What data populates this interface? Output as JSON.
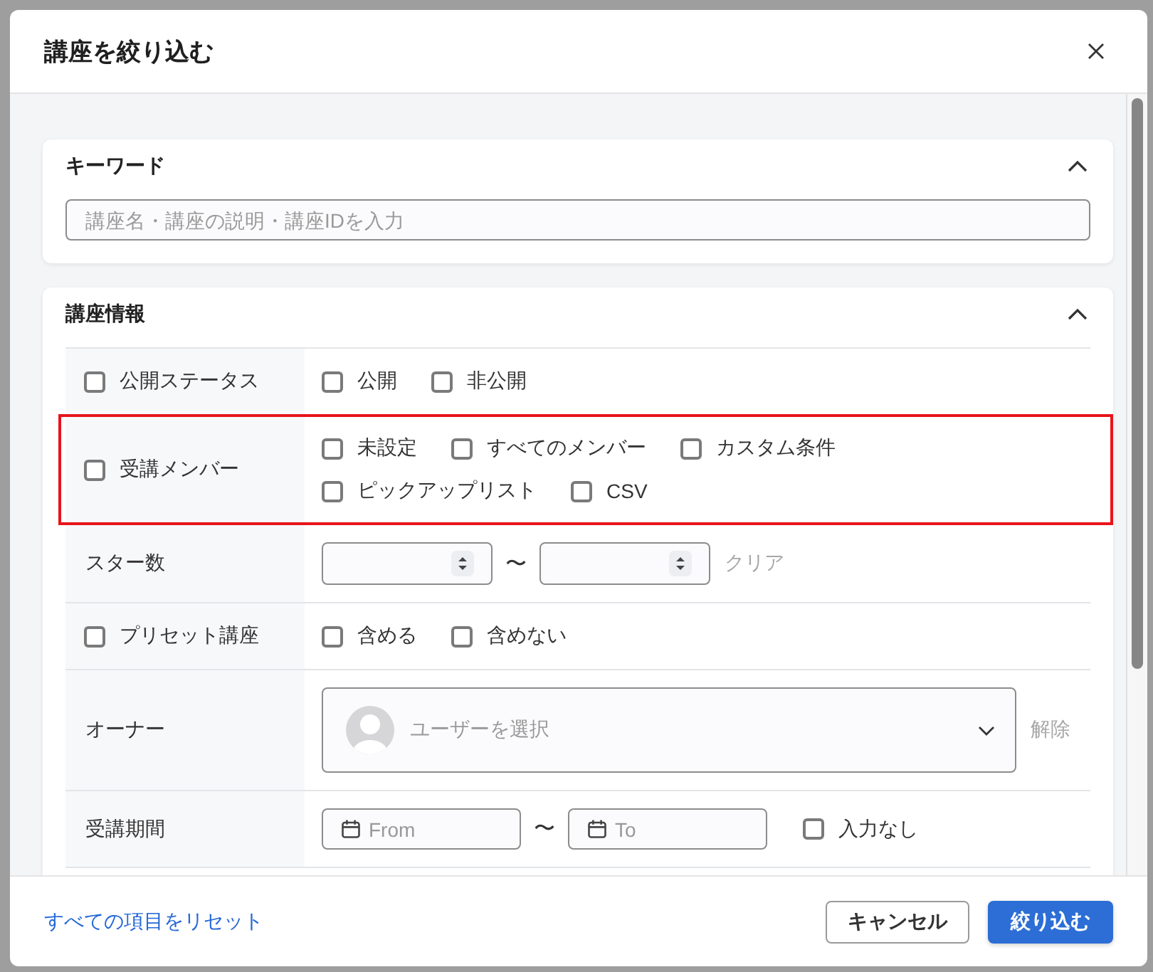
{
  "dialog": {
    "title": "講座を絞り込む"
  },
  "sections": [
    {
      "kind": "keyword",
      "title": "キーワード",
      "expanded": true,
      "search": {
        "placeholder": "講座名・講座の説明・講座IDを入力"
      }
    },
    {
      "kind": "table",
      "title": "講座情報",
      "expanded": true,
      "rows": [
        {
          "kind": "checks",
          "label": "公開ステータス",
          "checked": false,
          "highlighted": false,
          "options": [
            {
              "label": "公開",
              "checked": false
            },
            {
              "label": "非公開",
              "checked": false
            }
          ]
        },
        {
          "kind": "checks",
          "label": "受講メンバー",
          "checked": false,
          "highlighted": true,
          "options": [
            {
              "label": "未設定",
              "checked": false
            },
            {
              "label": "すべてのメンバー",
              "checked": false
            },
            {
              "label": "カスタム条件",
              "checked": false
            },
            {
              "label": "ピックアップリスト",
              "checked": false
            },
            {
              "label": "CSV",
              "checked": false
            }
          ]
        },
        {
          "kind": "number_range",
          "label": "スター数",
          "highlighted": false,
          "fields": [
            {
              "kind": "number"
            },
            {
              "kind": "number"
            }
          ],
          "separator": "〜",
          "clear_link": "クリア"
        },
        {
          "kind": "checks",
          "label": "プリセット講座",
          "checked": false,
          "highlighted": false,
          "options": [
            {
              "label": "含める",
              "checked": false
            },
            {
              "label": "含めない",
              "checked": false
            }
          ]
        },
        {
          "kind": "user_select",
          "label": "オーナー",
          "highlighted": false,
          "placeholder": "ユーザーを選択",
          "clear_link": "解除"
        },
        {
          "kind": "date_range",
          "label": "受講期間",
          "highlighted": false,
          "fields": [
            {
              "placeholder": "From"
            },
            {
              "placeholder": "To"
            }
          ],
          "separator": "〜",
          "no_input_option": {
            "label": "入力なし",
            "checked": false
          }
        }
      ]
    }
  ],
  "footer": {
    "reset_link": "すべての項目をリセット",
    "buttons": [
      {
        "kind": "secondary",
        "label": "キャンセル"
      },
      {
        "kind": "primary",
        "label": "絞り込む"
      }
    ]
  }
}
